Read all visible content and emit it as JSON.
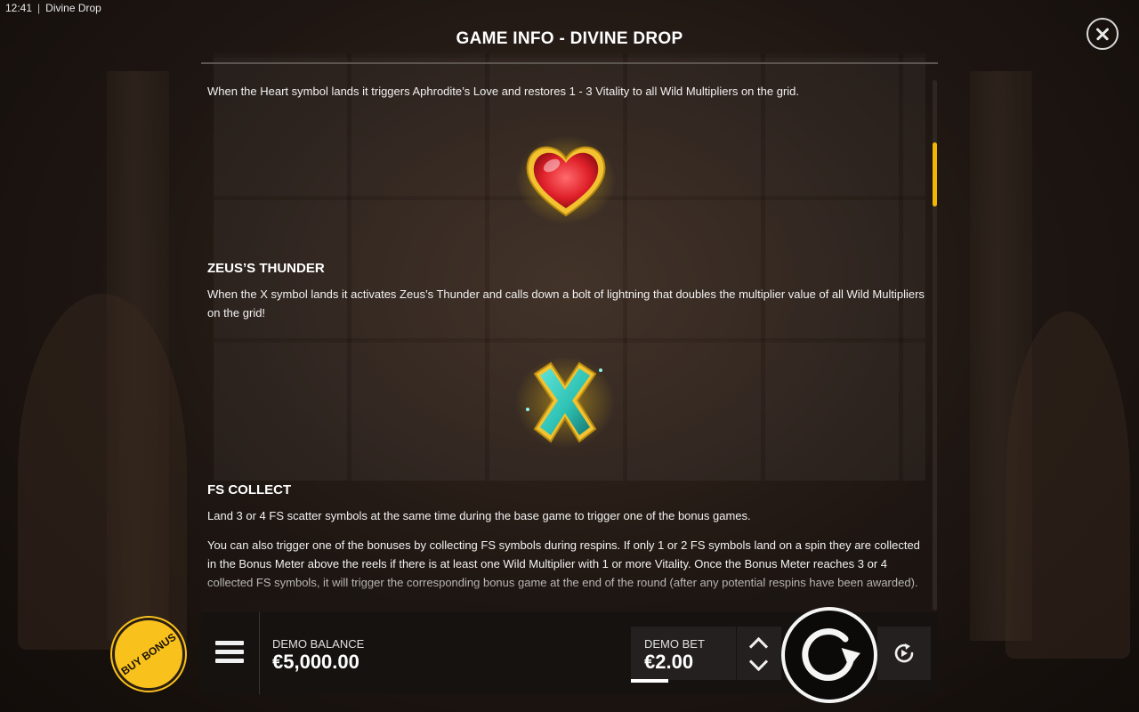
{
  "status_bar": {
    "time": "12:41",
    "app_name": "Divine Drop"
  },
  "header": {
    "title": "GAME INFO - DIVINE DROP"
  },
  "content": {
    "heart_para": "When the Heart symbol lands it triggers Aphrodite’s Love and restores 1 - 3 Vitality to all Wild Multipliers on the grid.",
    "zeus": {
      "heading": "ZEUS’S THUNDER",
      "text": "When the X symbol lands it activates Zeus’s Thunder and calls down a bolt of lightning that doubles the multiplier value of all Wild Multipliers on the grid!"
    },
    "fs_collect": {
      "heading": "FS COLLECT",
      "text1": "Land 3 or 4 FS scatter symbols at the same time during the base game to trigger one of the bonus games.",
      "text2": "You can also trigger one of the bonuses by collecting FS symbols during respins. If only 1 or 2 FS symbols land on a spin they are collected in the Bonus Meter above the reels if there is at least one Wild Multiplier with 1 or more Vitality. Once the Bonus Meter reaches 3 or 4 collected FS symbols, it will trigger the corresponding bonus game at the end of the round (after any potential respins have been awarded)."
    }
  },
  "bottom_bar": {
    "buy_bonus": "BUY BONUS",
    "balance_label": "DEMO BALANCE",
    "balance_value": "€5,000.00",
    "bet_label": "DEMO BET",
    "bet_value": "€2.00"
  },
  "colors": {
    "accent_yellow": "#f9c11c",
    "scroll_thumb": "#f2b705",
    "heart_red": "#e0202a",
    "x_teal": "#2fc3b6",
    "glow_gold": "#f5c518"
  }
}
